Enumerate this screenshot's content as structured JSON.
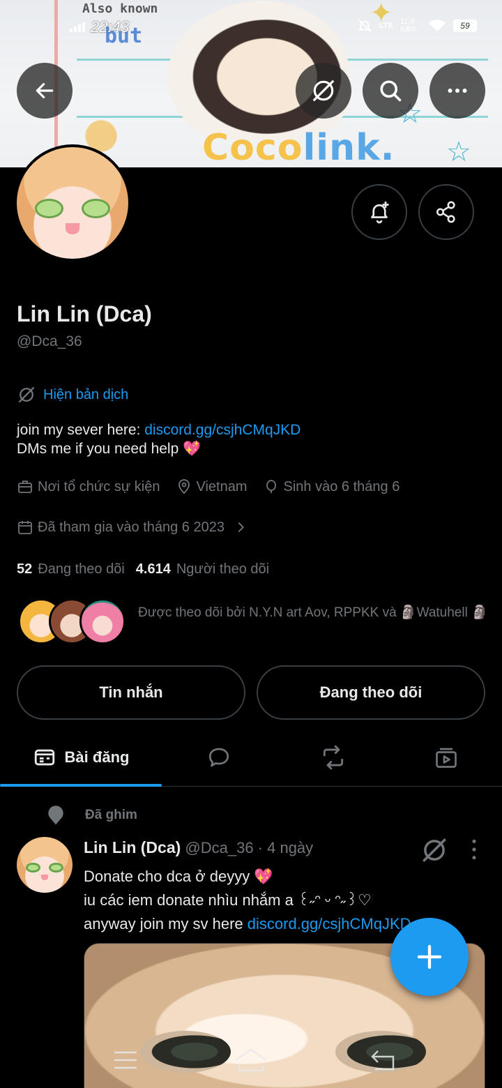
{
  "status_bar": {
    "time": "22:43",
    "network": "LTE",
    "speed": "11,0 KB/s",
    "battery": "59"
  },
  "banner": {
    "scribble_top": "Also known",
    "scribble_but": "but",
    "wordmark": "Cocolink."
  },
  "header": {
    "back_icon": "arrow-left-icon",
    "translate_icon": "no-translate-icon",
    "search_icon": "search-icon",
    "more_icon": "more-horizontal-icon"
  },
  "profile": {
    "name": "Lin Lin (Dca)",
    "handle": "@Dca_36",
    "translate_label": "Hiện bản dịch",
    "bio_line1_prefix": "join my sever here: ",
    "bio_link": "discord.gg/csjhCMqJKD",
    "bio_line2": "DMs me if you need help 💖",
    "category": "Nơi tổ chức sự kiện",
    "location": "Vietnam",
    "birthday": "Sinh vào 6 tháng 6",
    "joined": "Đã tham gia vào tháng 6 2023",
    "following_count": "52",
    "following_label": "Đang theo dõi",
    "followers_count": "4.614",
    "followers_label": "Người theo dõi",
    "followed_by": "Được theo dõi bởi N.Y.N art Aov, RPPKK và 🗿Watuhell 🗿"
  },
  "actions": {
    "message": "Tin nhắn",
    "following": "Đang theo dõi"
  },
  "tabs": {
    "posts": "Bài đăng"
  },
  "pinned_post": {
    "pinned_label": "Đã ghim",
    "author": "Lin Lin (Dca)",
    "meta": " @Dca_36 · 4 ngày",
    "line1": "Donate cho dca ở deyyy 💖",
    "line2": "iu các iem donate nhìu nhắm a ꒰˶ᵔ ᵕ ᵔ˶꒱♡",
    "line3_prefix": "anyway join my sv here ",
    "line3_link": "discord.gg/csjhCMqJKD"
  },
  "colors": {
    "accent": "#1d9bf0",
    "background": "#000000",
    "text": "#e7e9ea",
    "secondary": "#71767b",
    "border": "#3a3f44"
  }
}
